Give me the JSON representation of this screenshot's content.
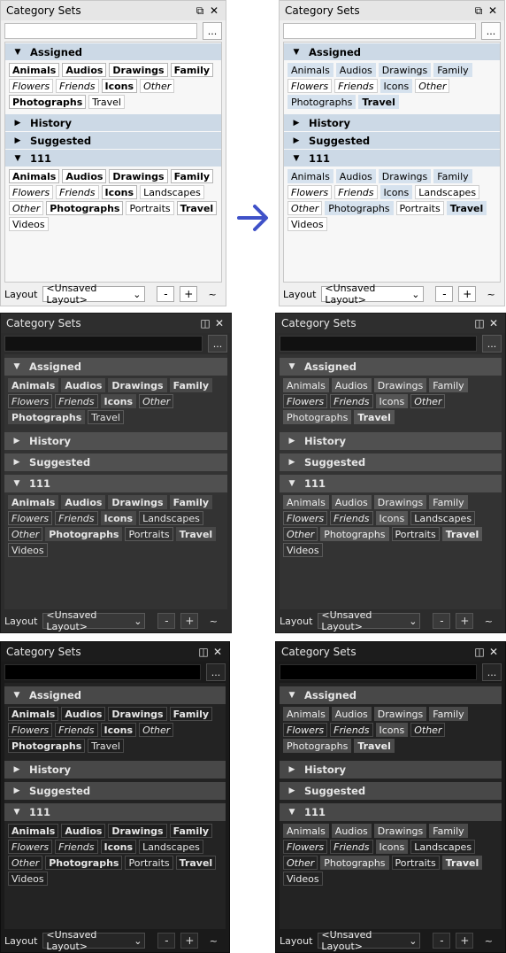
{
  "panel_title": "Category Sets",
  "search_value": "",
  "more_button": "...",
  "layout_label": "Layout",
  "layout_value": "<Unsaved Layout>",
  "minus_label": "-",
  "plus_label": "+",
  "grip_label": "~",
  "sections": {
    "assigned": "Assigned",
    "history": "History",
    "suggested": "Suggested",
    "set111": "111"
  },
  "assigned_tags": [
    {
      "text": "Animals",
      "style": "bold"
    },
    {
      "text": "Audios",
      "style": "bold"
    },
    {
      "text": "Drawings",
      "style": "bold"
    },
    {
      "text": "Family",
      "style": "bold"
    },
    {
      "text": "Flowers",
      "style": "italic"
    },
    {
      "text": "Friends",
      "style": "italic"
    },
    {
      "text": "Icons",
      "style": "bold"
    },
    {
      "text": "Other",
      "style": "italic"
    },
    {
      "text": "Photographs",
      "style": "bold"
    },
    {
      "text": "Travel",
      "style": "normal"
    }
  ],
  "assigned_tags_after": [
    {
      "text": "Animals",
      "style": "normal"
    },
    {
      "text": "Audios",
      "style": "normal"
    },
    {
      "text": "Drawings",
      "style": "normal"
    },
    {
      "text": "Family",
      "style": "normal"
    },
    {
      "text": "Flowers",
      "style": "italic"
    },
    {
      "text": "Friends",
      "style": "italic"
    },
    {
      "text": "Icons",
      "style": "normal"
    },
    {
      "text": "Other",
      "style": "italic"
    },
    {
      "text": "Photographs",
      "style": "normal"
    },
    {
      "text": "Travel",
      "style": "bold"
    }
  ],
  "set111_tags": [
    {
      "text": "Animals",
      "style": "bold"
    },
    {
      "text": "Audios",
      "style": "bold"
    },
    {
      "text": "Drawings",
      "style": "bold"
    },
    {
      "text": "Family",
      "style": "bold"
    },
    {
      "text": "Flowers",
      "style": "italic"
    },
    {
      "text": "Friends",
      "style": "italic"
    },
    {
      "text": "Icons",
      "style": "bold"
    },
    {
      "text": "Landscapes",
      "style": "normal"
    },
    {
      "text": "Other",
      "style": "italic"
    },
    {
      "text": "Photographs",
      "style": "bold"
    },
    {
      "text": "Portraits",
      "style": "normal"
    },
    {
      "text": "Travel",
      "style": "bold"
    },
    {
      "text": "Videos",
      "style": "normal"
    }
  ],
  "set111_tags_after": [
    {
      "text": "Animals",
      "style": "normal"
    },
    {
      "text": "Audios",
      "style": "normal"
    },
    {
      "text": "Drawings",
      "style": "normal"
    },
    {
      "text": "Family",
      "style": "normal"
    },
    {
      "text": "Flowers",
      "style": "italic"
    },
    {
      "text": "Friends",
      "style": "italic"
    },
    {
      "text": "Icons",
      "style": "normal"
    },
    {
      "text": "Landscapes",
      "style": "plain"
    },
    {
      "text": "Other",
      "style": "italic"
    },
    {
      "text": "Photographs",
      "style": "normal"
    },
    {
      "text": "Portraits",
      "style": "plain"
    },
    {
      "text": "Travel",
      "style": "bold"
    },
    {
      "text": "Videos",
      "style": "plain"
    }
  ],
  "colors": {
    "arrow": "#3f51c8"
  },
  "icons": {
    "float": "float-window-icon",
    "close": "close-icon",
    "expanded": "triangle-down-icon",
    "collapsed": "triangle-right-icon",
    "dropdown": "chevron-down-icon",
    "transition": "right-arrow-icon"
  }
}
